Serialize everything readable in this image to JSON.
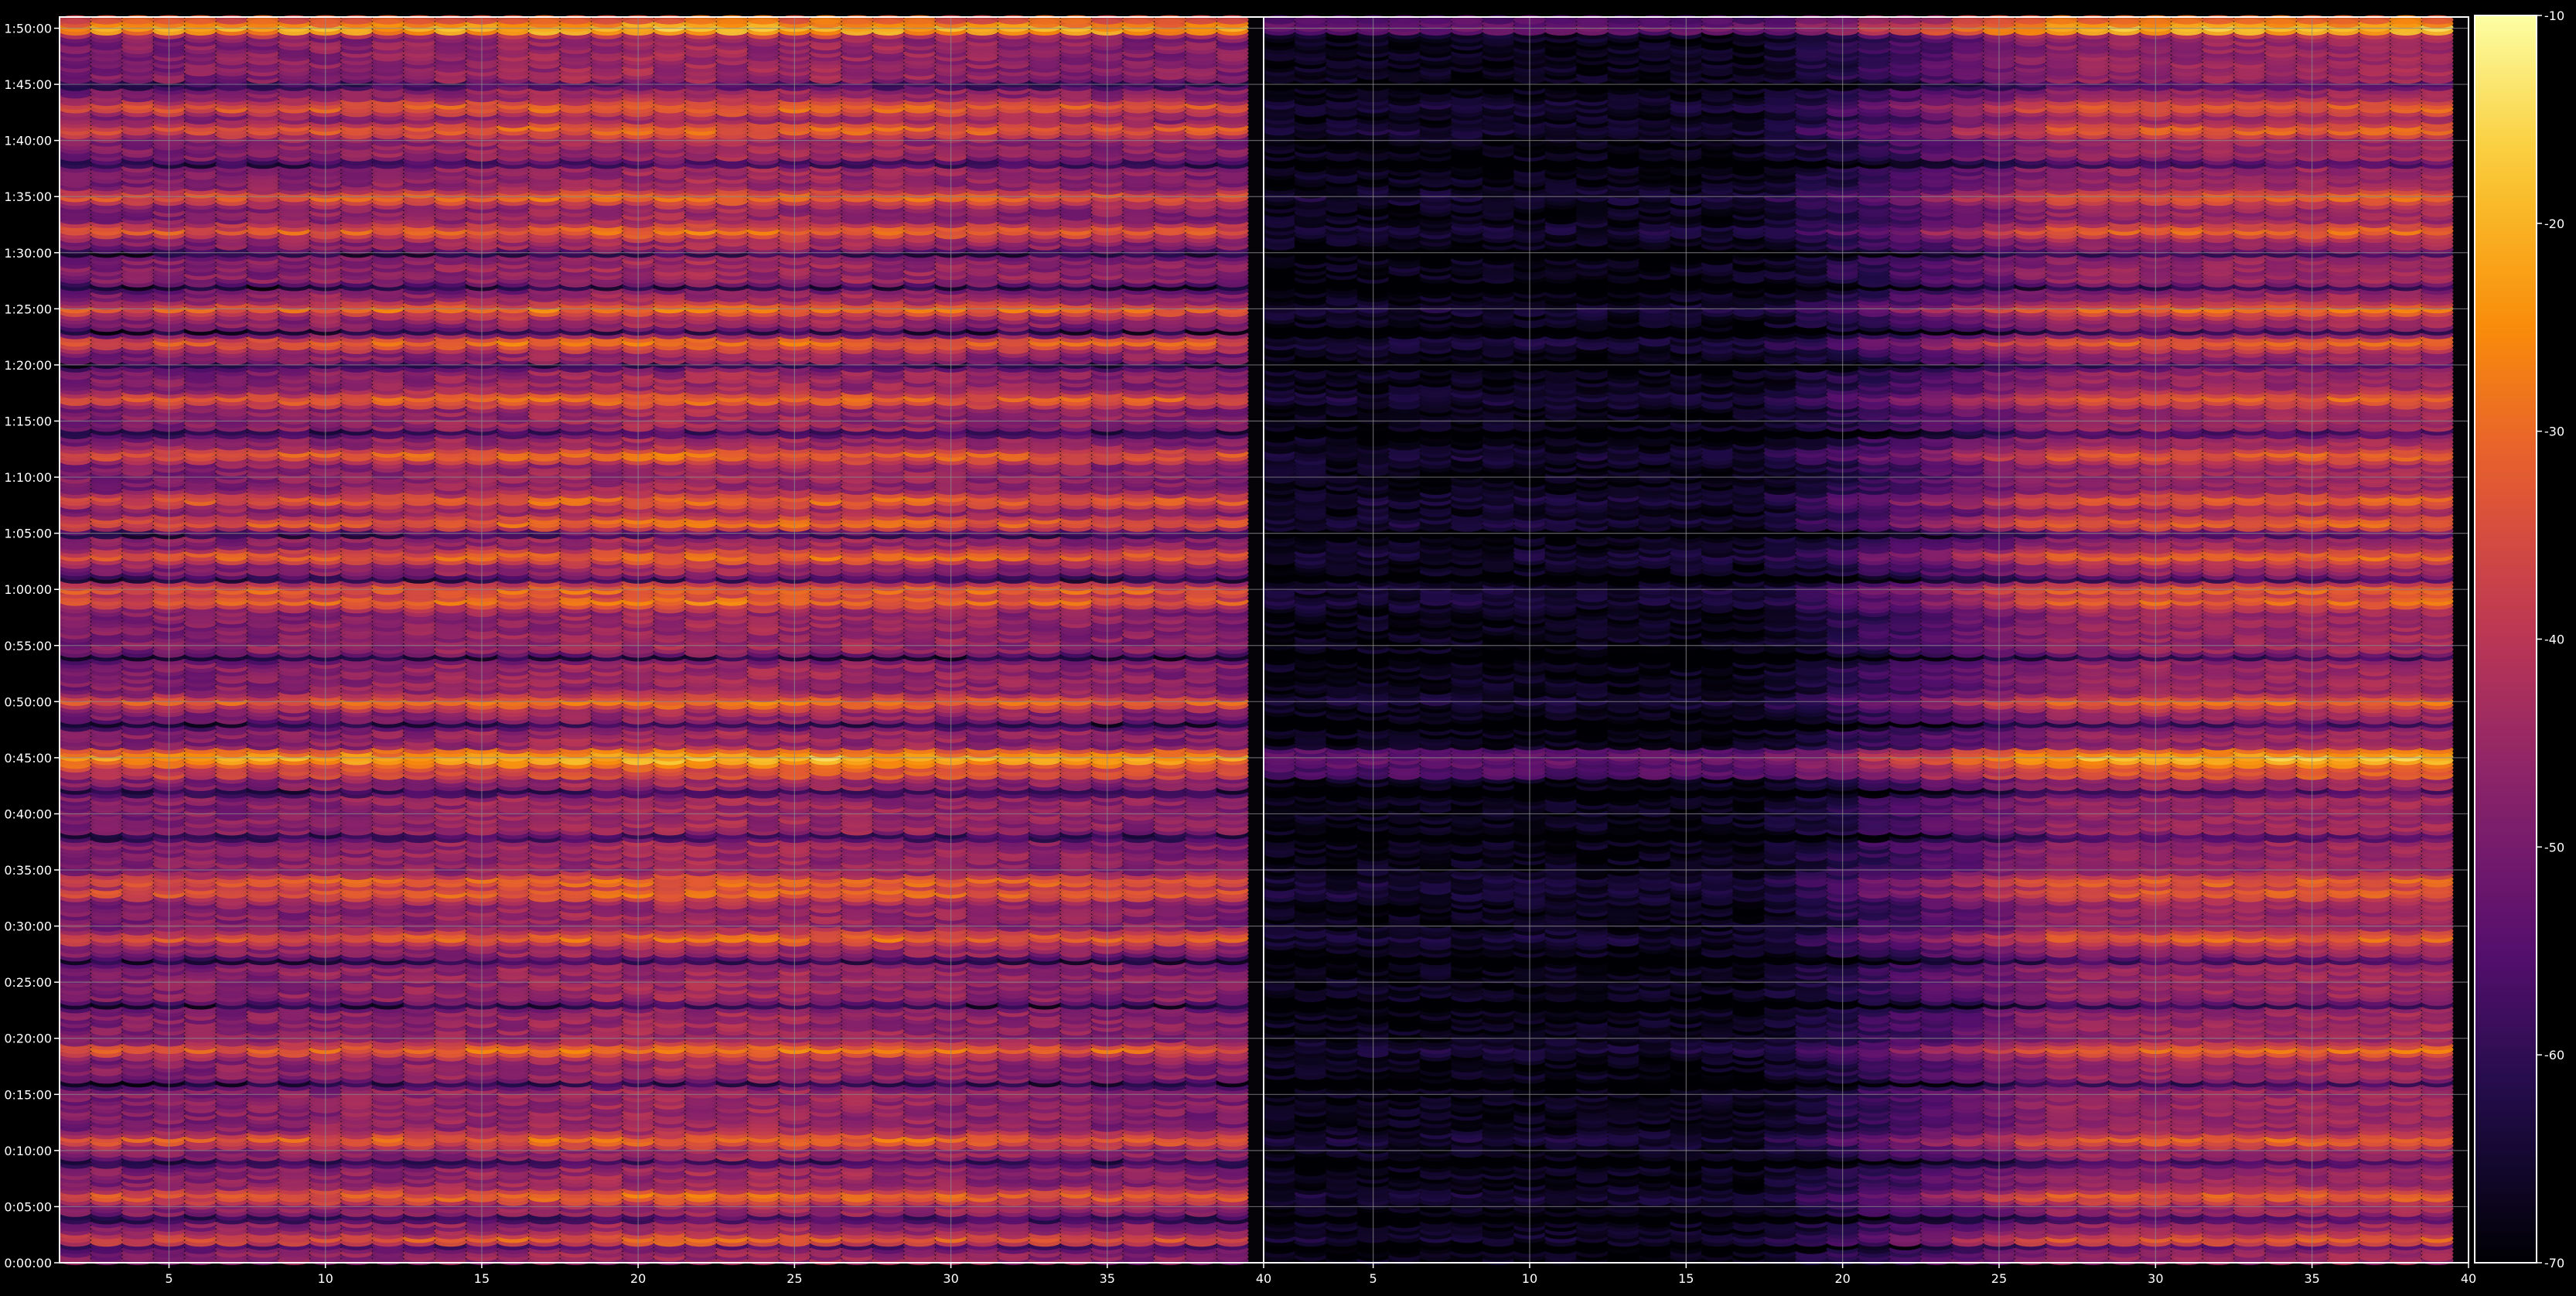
{
  "chart_data": [
    {
      "type": "heatmap",
      "panel": "left",
      "x_ticks": [
        5,
        10,
        15,
        20,
        25,
        30,
        35,
        40
      ],
      "xlim": [
        1.5,
        40
      ],
      "y_ticks": [
        "0:00:00",
        "0:05:00",
        "0:10:00",
        "0:15:00",
        "0:20:00",
        "0:25:00",
        "0:30:00",
        "0:35:00",
        "0:40:00",
        "0:45:00",
        "0:50:00",
        "0:55:00",
        "1:00:00",
        "1:05:00",
        "1:10:00",
        "1:15:00",
        "1:20:00",
        "1:25:00",
        "1:30:00",
        "1:35:00",
        "1:40:00",
        "1:45:00",
        "1:50:00"
      ],
      "ylim_minutes": [
        0,
        111
      ],
      "grid": true,
      "value_range": [
        -70,
        -10
      ],
      "colormap": "inferno",
      "bright_rows_minutes": [
        2,
        6,
        11,
        19,
        29,
        33,
        34,
        45,
        50,
        59,
        60,
        63,
        66,
        68,
        72,
        77,
        82,
        85,
        92,
        95,
        101,
        103,
        110
      ],
      "gap_rows_minutes": [
        1.5,
        4,
        9,
        16,
        23,
        27,
        38,
        42,
        48,
        54,
        61,
        65,
        74,
        80,
        83,
        87,
        90,
        98,
        105
      ],
      "description_values": "Signal level (dB) per 1-unit column × ~20 s row; stronger across whole width, strongest near 0:44–0:46 and 1:50"
    },
    {
      "type": "heatmap",
      "panel": "right",
      "x_ticks": [
        5,
        10,
        15,
        20,
        25,
        30,
        35,
        40
      ],
      "xlim": [
        1.5,
        40
      ],
      "y_ticks": [
        "0:00:00",
        "0:05:00",
        "0:10:00",
        "0:15:00",
        "0:20:00",
        "0:25:00",
        "0:30:00",
        "0:35:00",
        "0:40:00",
        "0:45:00",
        "0:50:00",
        "0:55:00",
        "1:00:00",
        "1:05:00",
        "1:10:00",
        "1:15:00",
        "1:20:00",
        "1:25:00",
        "1:30:00",
        "1:35:00",
        "1:40:00",
        "1:45:00",
        "1:50:00"
      ],
      "ylim_minutes": [
        0,
        111
      ],
      "grid": true,
      "value_range": [
        -70,
        -10
      ],
      "colormap": "inferno",
      "bright_rows_minutes": [
        2,
        6,
        11,
        19,
        29,
        33,
        34,
        45,
        50,
        59,
        60,
        63,
        66,
        68,
        72,
        77,
        82,
        85,
        92,
        95,
        101,
        103,
        110
      ],
      "gap_rows_minutes": [
        1.5,
        4,
        9,
        16,
        23,
        27,
        38,
        42,
        48,
        54,
        61,
        65,
        74,
        80,
        83,
        87,
        90,
        98,
        105
      ],
      "description_values": "Weak (near -70 dB) for columns below ~20, rising toward the right edge; strongest rows near 0:44–0:46"
    }
  ],
  "colorbar": {
    "ticks": [
      -10,
      -20,
      -30,
      -40,
      -50,
      -60,
      -70
    ],
    "range": [
      -70,
      -10
    ],
    "colormap": "inferno"
  },
  "colors": {
    "background": "#000000",
    "grid": "#8a8a8a",
    "axis": "#ffffff"
  }
}
